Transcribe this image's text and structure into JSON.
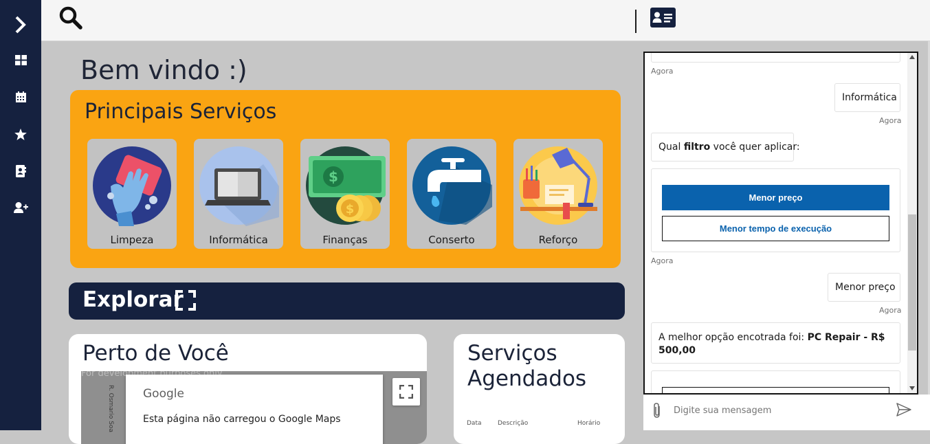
{
  "sidebar": {
    "items": [
      {
        "icon": "chevron-right-icon"
      },
      {
        "icon": "dashboard-icon"
      },
      {
        "icon": "calendar-icon"
      },
      {
        "icon": "star-icon"
      },
      {
        "icon": "contacts-icon"
      },
      {
        "icon": "add-user-icon"
      }
    ]
  },
  "header": {
    "search_icon": "search-icon",
    "profile_icon": "id-card-icon"
  },
  "main": {
    "welcome": "Bem vindo :)",
    "services": {
      "title": "Principais Serviços",
      "items": [
        {
          "label": "Limpeza",
          "icon": "cleaning-glove-icon"
        },
        {
          "label": "Informática",
          "icon": "laptop-icon"
        },
        {
          "label": "Finanças",
          "icon": "money-icon"
        },
        {
          "label": "Conserto",
          "icon": "faucet-icon"
        },
        {
          "label": "Reforço",
          "icon": "desk-lamp-icon"
        }
      ]
    },
    "explore": {
      "label": "Explorar"
    },
    "near": {
      "title": "Perto de Você",
      "map": {
        "brand": "Google",
        "error": "Esta página não carregou o Google Maps",
        "watermark": "For development purposes only",
        "street": "R. Osmario Soa"
      }
    },
    "scheduled": {
      "title": "Serviços Agendados",
      "columns": [
        "Data",
        "Descrição",
        "Horário"
      ]
    }
  },
  "chat": {
    "messages": [
      {
        "side": "left",
        "text": "",
        "time": "Agora"
      },
      {
        "side": "right",
        "text": "Informática",
        "time": "Agora"
      },
      {
        "side": "left",
        "pre": "Qual ",
        "bold": "filtro",
        "post": " você quer aplicar:"
      },
      {
        "side": "left",
        "options": [
          "Menor preço",
          "Menor tempo de execução"
        ],
        "time": "Agora"
      },
      {
        "side": "right",
        "text": "Menor preço",
        "time": "Agora"
      },
      {
        "side": "left",
        "pre": "A melhor opção encotrada foi: ",
        "bold": "PC Repair - R$ 500,00"
      }
    ],
    "input_placeholder": "Digite sua mensagem"
  },
  "colors": {
    "navy": "#15213f",
    "orange": "#faa412",
    "blue_button": "#0a62ad"
  }
}
